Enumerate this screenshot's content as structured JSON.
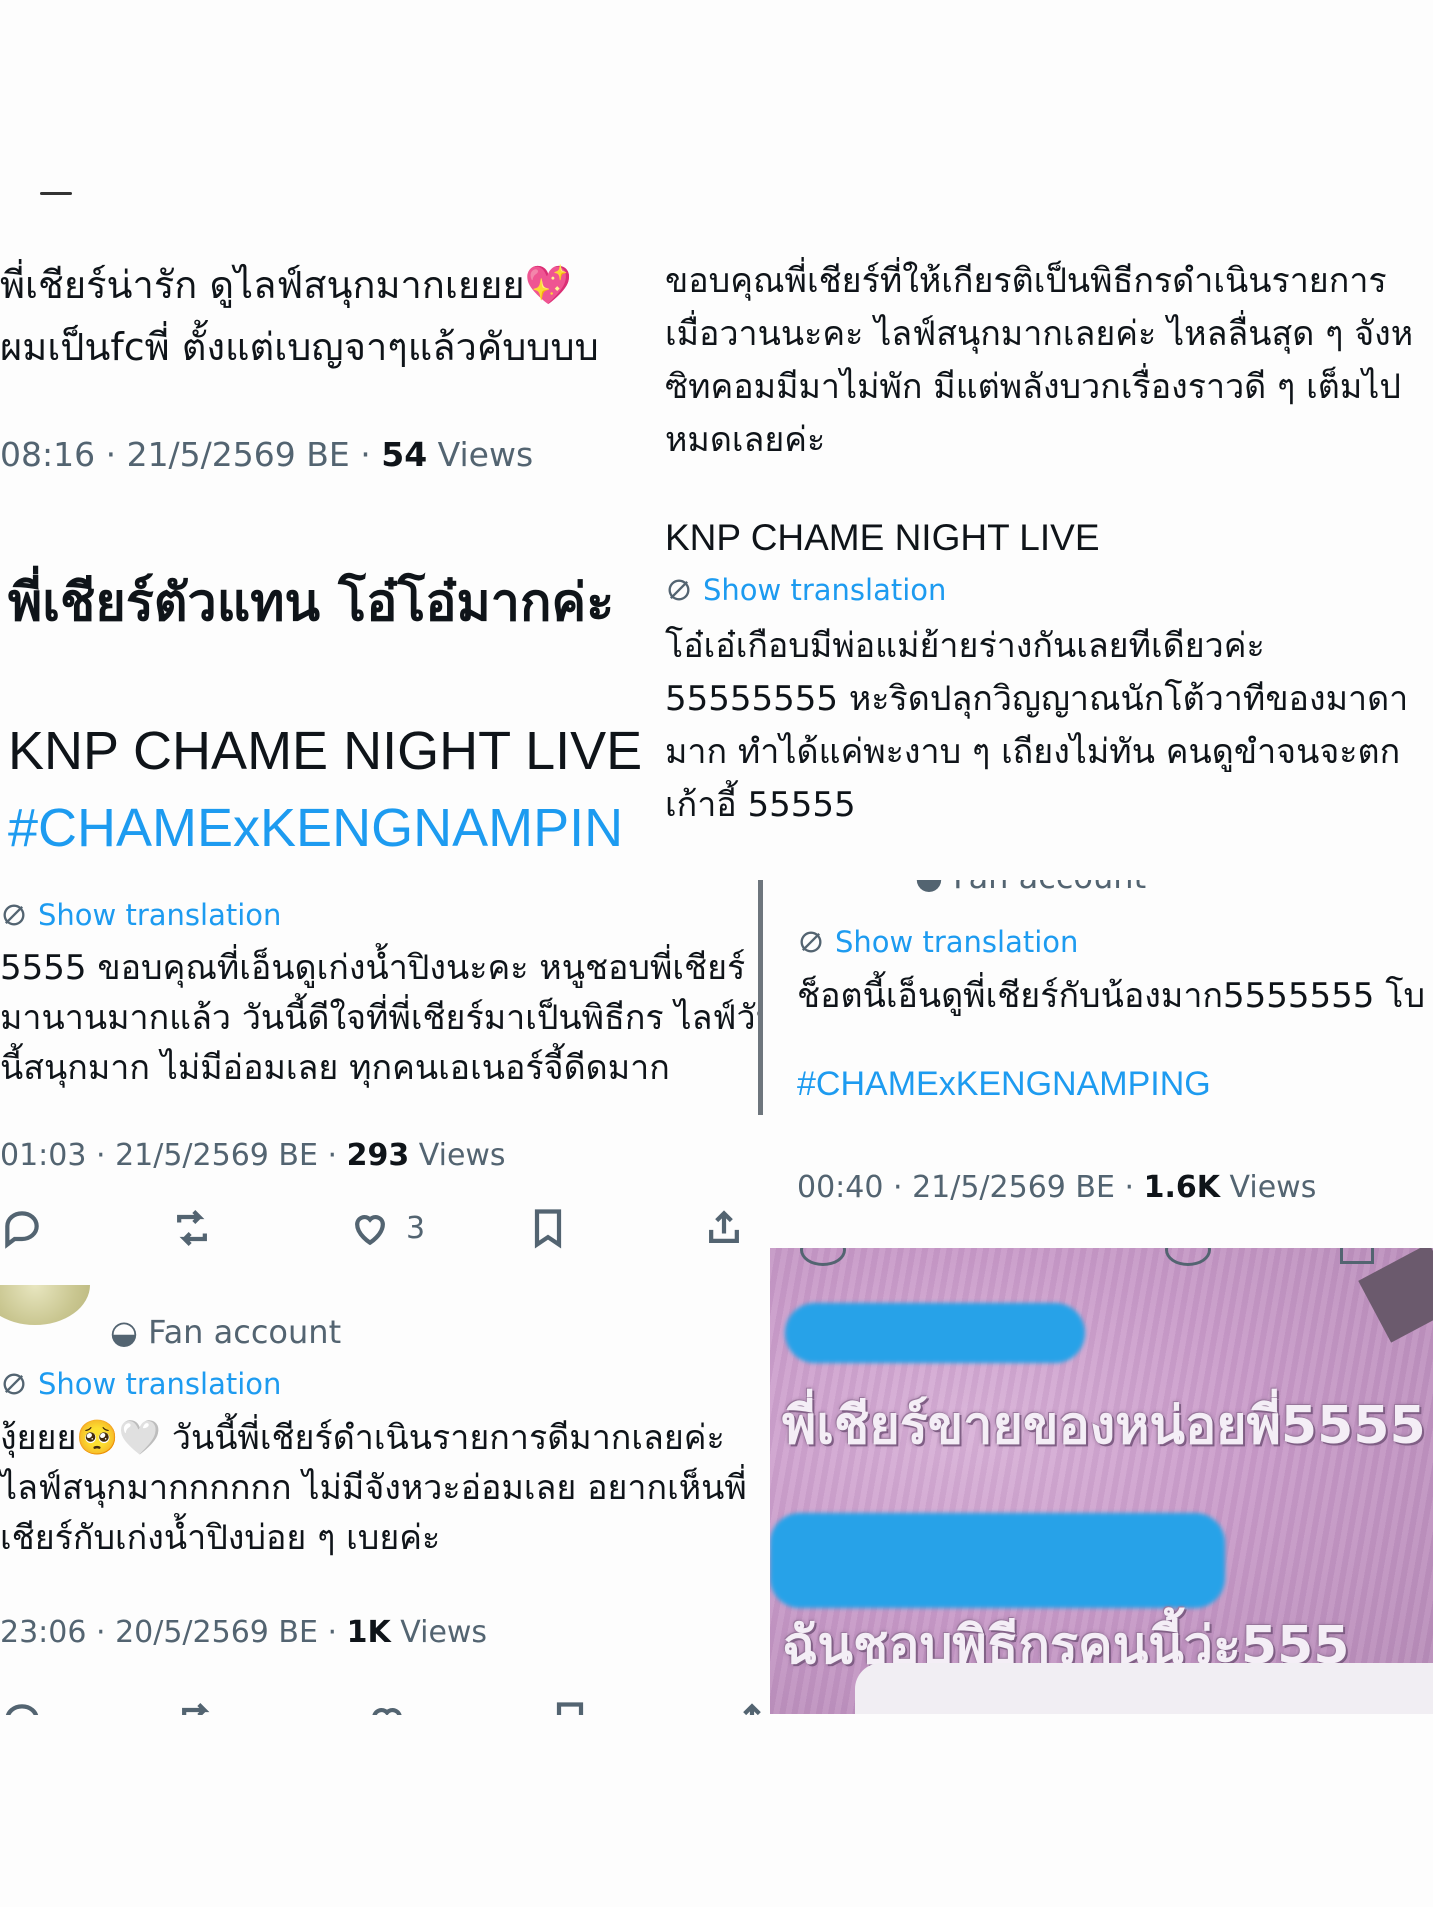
{
  "tweet_a": {
    "line1": "พี่เชียร์น่ารัก ดูไลฟ์สนุกมากเยยย",
    "line1_emoji": "💖",
    "line2": "ผมเป็นfcพี่ ตั้งแต่เบญจาๆแล้วคับบบบ",
    "time": "08:16 · 21/5/2569 BE · ",
    "views_count": "54",
    "views_label": " Views"
  },
  "tweet_b": {
    "line1": "ขอบคุณพี่เชียร์ที่ให้เกียรติเป็นพิธีกรดำเนินรายการ",
    "line2": "เมื่อวานนะคะ ไลฟ์สนุกมากเลยค่ะ ไหลลื่นสุด ๆ จังห",
    "line3": "ซิทคอมมีมาไม่พัก มีแต่พลังบวกเรื่องราวดี ๆ เต็มไป",
    "line4": "หมดเลยค่ะ",
    "tag_line": "KNP CHAME NIGHT LIVE",
    "show_translation": "Show translation",
    "tr_line1": "โอ๋เอ๋เกือบมีพ่อแม่ย้ายร่างกันเลยทีเดียวค่ะ",
    "tr_line2": "55555555 หะริดปลุกวิญญาณนักโต้วาทีของมาดา",
    "tr_line3": "มาก ทำได้แค่พะงาบ ๆ เถียงไม่ทัน คนดูขำจนจะตก",
    "tr_line4": "เก้าอี้ 55555"
  },
  "tweet_c": {
    "big_line": "พี่เชียร์ตัวแทน โอ๋โอ๋มากค่ะ",
    "event": "KNP CHAME NIGHT LIVE",
    "hashtag": "#CHAMExKENGNAMPIN"
  },
  "tweet_d": {
    "show_translation": "Show translation",
    "line1": "5555 ขอบคุณที่เอ็นดูเก่งน้ำปิงนะคะ หนูชอบพี่เชียร์",
    "line2": "มานานมากแล้ว วันนี้ดีใจที่พี่เชียร์มาเป็นพิธีกร ไลฟ์วัน",
    "line3": "นี้สนุกมาก ไม่มีอ่อมเลย ทุกคนเอเนอร์จี้ดีดมาก",
    "time": "01:03 · 21/5/2569 BE · ",
    "views_count": "293",
    "views_label": " Views",
    "like_count": "3"
  },
  "tweet_e": {
    "fan_account": "Fan account",
    "show_translation": "Show translation",
    "line1": "ช็อตนี้เอ็นดูพี่เชียร์กับน้องมาก5555555 โบ",
    "hashtag": "#CHAMExKENGNAMPING",
    "time": "00:40 · 21/5/2569 BE · ",
    "views_count": "1.6K",
    "views_label": " Views"
  },
  "tweet_f": {
    "fan_account": "Fan account",
    "show_translation": "Show translation",
    "line1_pre": "งุ้ยยย",
    "line1_emoji": "🥺🤍",
    "line1_post": " วันนี้พี่เชียร์ดำเนินรายการดีมากเลยค่ะ",
    "line2": "ไลฟ์สนุกมากกกกกก ไม่มีจังหวะอ่อมเลย อยากเห็นพี่",
    "line3": "เชียร์กับเก่งน้ำปิงบ่อย ๆ เบยค่ะ",
    "time": "23:06 · 20/5/2569 BE · ",
    "views_count": "1K",
    "views_label": " Views"
  },
  "live_capture": {
    "comment1": "พี่เชียร์ขายของหน่อยพี่5555",
    "comment2": "ฉันชอบพิธีกรคนนี้ว่ะ555"
  },
  "colors": {
    "link": "#1d9bf0",
    "meta": "#536471",
    "text": "#0f1419",
    "scribble": "#27a2e8"
  }
}
